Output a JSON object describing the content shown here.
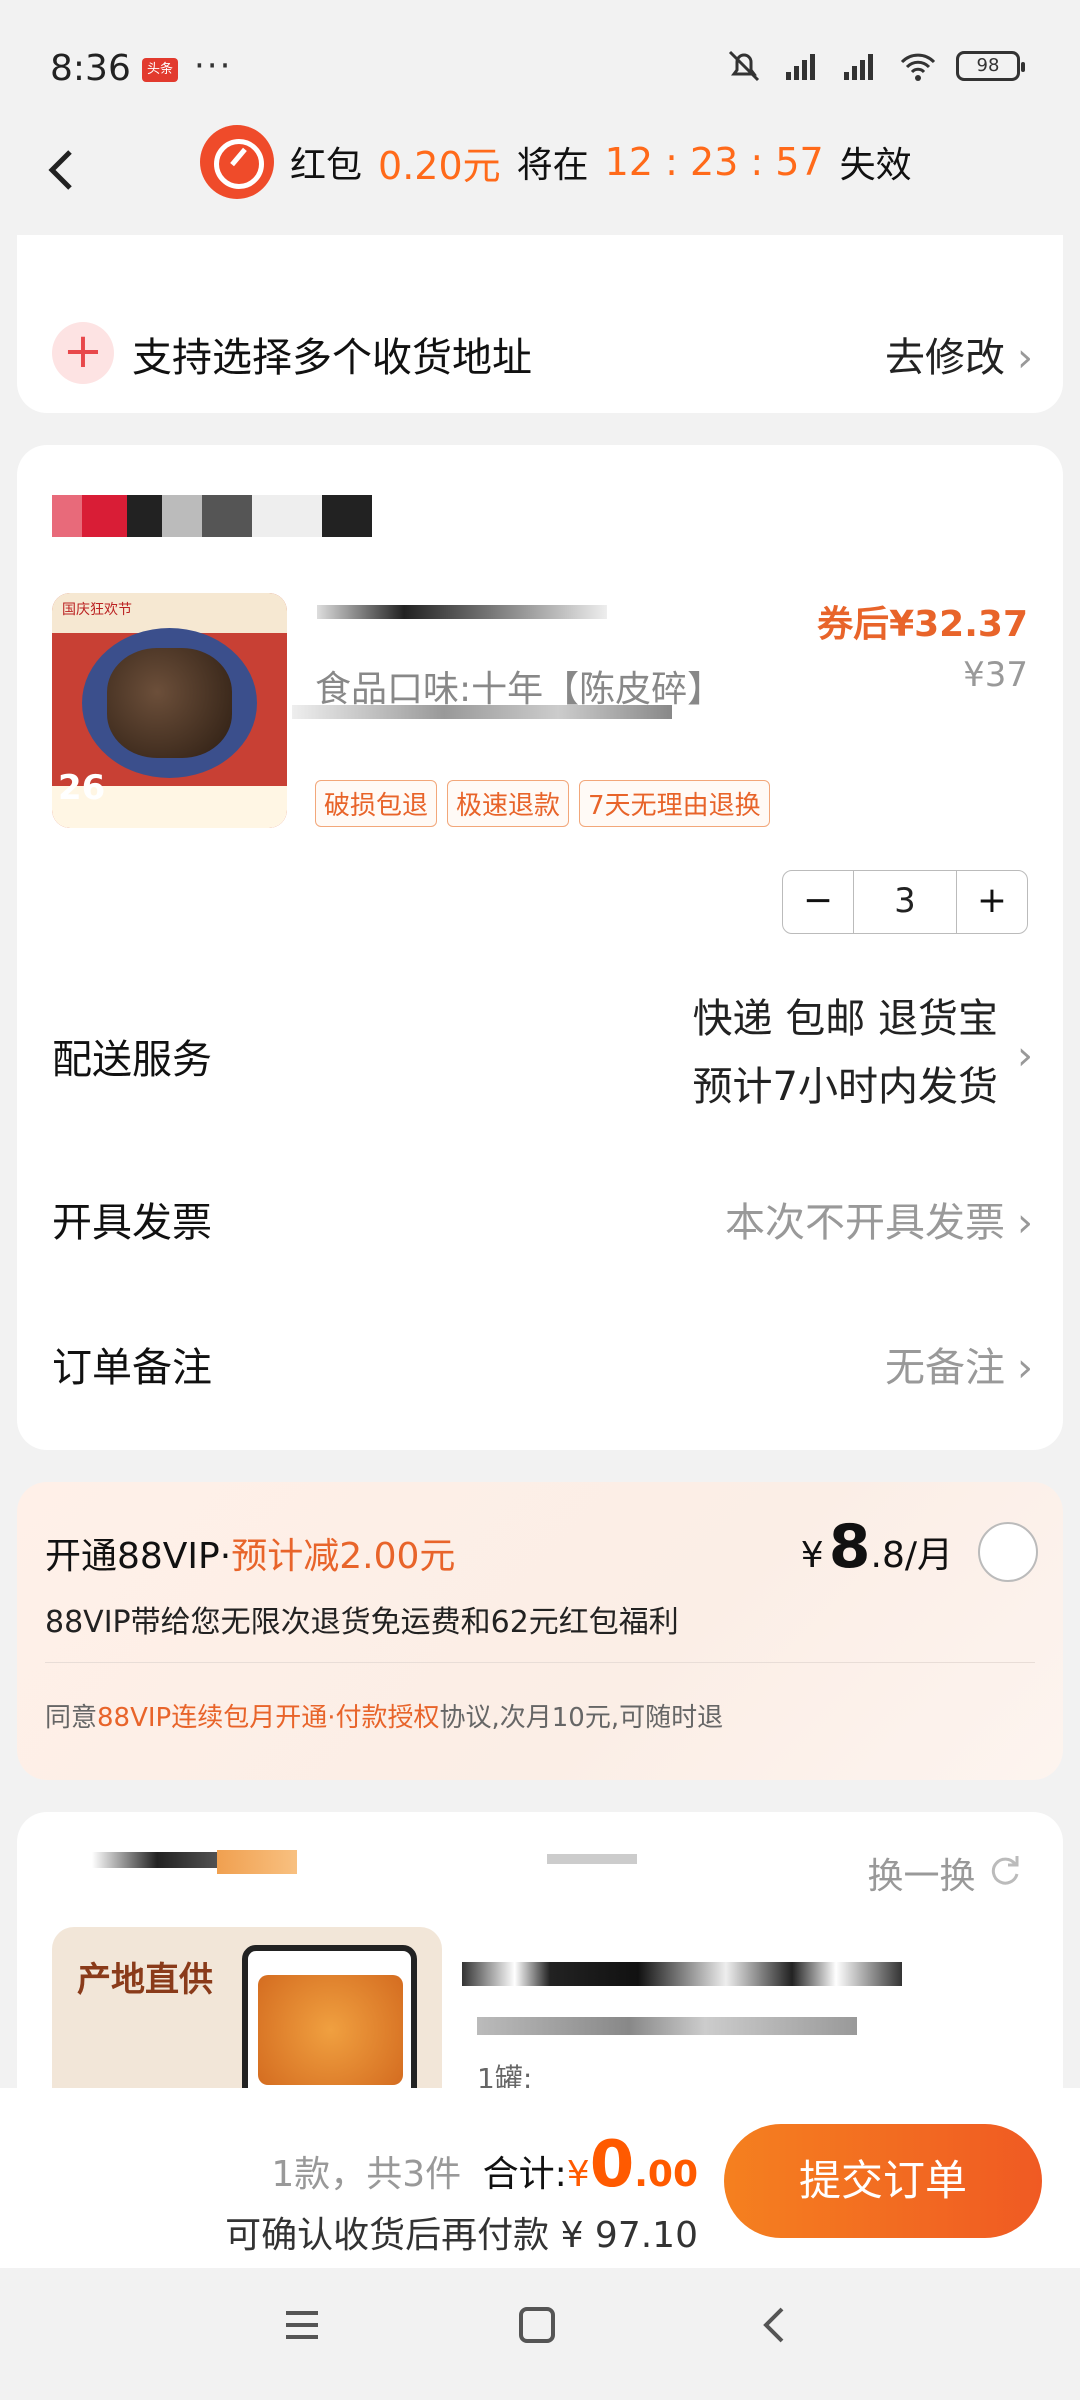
{
  "status_bar": {
    "time": "8:36",
    "app_badge": "头条",
    "dots": "···",
    "battery": "98"
  },
  "header": {
    "hongbao_label": "红包",
    "amount": "0.20元",
    "will_text": "将在",
    "countdown": "12 : 23 : 57",
    "expire_text": "失效"
  },
  "address": {
    "multi_label": "支持选择多个收货地址",
    "modify_label": "去修改"
  },
  "product": {
    "variant": "食品口味:十年【陈皮碎】",
    "coupon_price": "券后¥32.37",
    "original_price": "¥37",
    "thumb_tag": "国庆狂欢节",
    "thumb_num": "26",
    "tags": [
      "破损包退",
      "极速退款",
      "7天无理由退换"
    ],
    "quantity": "3"
  },
  "rows": {
    "delivery_label": "配送服务",
    "delivery_line1": "快递 包邮 退货宝",
    "delivery_line2": "预计7小时内发货",
    "invoice_label": "开具发票",
    "invoice_value": "本次不开具发票",
    "note_label": "订单备注",
    "note_value": "无备注"
  },
  "vip": {
    "title": "开通88VIP·",
    "save": "预计减2.00元",
    "yen": "¥",
    "price_int": "8",
    "price_dec": ".8",
    "per_month": "/月",
    "desc": "88VIP带给您无限次退货免运费和62元红包福利",
    "agree_pre": "同意",
    "agree_link": "88VIP连续包月开通·付款授权",
    "agree_post": "协议,次月10元,可随时退"
  },
  "recommend": {
    "refresh": "换一换",
    "thumb_text": "产地直供",
    "qty_label": "1罐:"
  },
  "bottom": {
    "count": "1款，共3件",
    "total_label": "合计:",
    "total_yen": "¥",
    "total_int": "0",
    "total_dec": ".00",
    "pay_later": "可确认收货后再付款 ¥ 97.10",
    "submit": "提交订单"
  }
}
